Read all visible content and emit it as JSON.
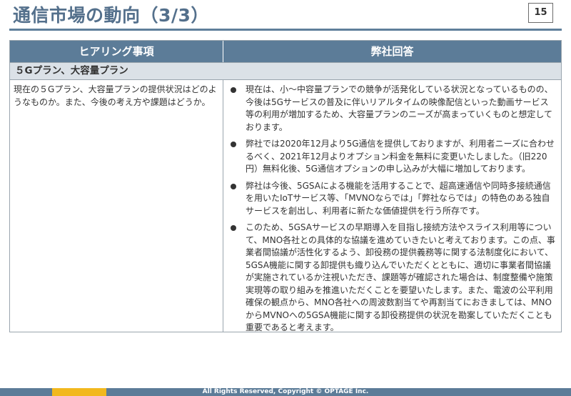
{
  "page": {
    "title": "通信市場の動向（3/3）",
    "page_number": "15"
  },
  "table": {
    "header_left": "ヒアリング事項",
    "header_right": "弊社回答",
    "section_label": "５Gプラン、大容量プラン",
    "question": "現在の５Gプラン、大容量プランの提供状況はどのようなものか。また、今後の考え方や課題はどうか。",
    "answers": [
      "現在は、小～中容量プランでの競争が活発化している状況となっているものの、今後は5Gサービスの普及に伴いリアルタイムの映像配信といった動画サービス等の利用が増加するため、大容量プランのニーズが高まっていくものと想定しております。",
      "弊社では2020年12月より5G通信を提供しておりますが、利用者ニーズに合わせるべく、2021年12月よりオプション料金を無料に変更いたしました。（旧220円）無料化後、5G通信オプションの申し込みが大幅に増加しております。",
      "弊社は今後、5GSAによる機能を活用することで、超高速通信や同時多接続通信を用いたIoTサービス等、「MVNOならでは」「弊社ならでは」の特色のある独自サービスを創出し、利用者に新たな価値提供を行う所存です。",
      "このため、5GSAサービスの早期導入を目指し接続方法やスライス利用等について、MNO各社との具体的な協議を進めていきたいと考えております。この点、事業者間協議が活性化するよう、卸役務の提供義務等に関する法制度化において、5GSA機能に関する卸提供も織り込んでいただくとともに、適切に事業者間協議が実施されているか注視いただき、課題等が確認された場合は、制度整備や施策実現等の取り組みを推進いただくことを要望いたします。また、電波の公平利用確保の観点から、MNO各社への周波数割当てや再割当てにおきましては、MNOからMVNOへの5GSA機能に関する卸役務提供の状況を勘案していただくことも重要であると考えます。"
    ]
  },
  "footer": {
    "copyright": "All Rights Reserved, Copyright © OPTAGE Inc."
  },
  "colors": {
    "title": "#54708c",
    "header_bg": "#5c7c98",
    "section_bg": "#dbe1e7",
    "footer_bar": "#5c7c98",
    "footer_accent": "#f2b81e"
  }
}
